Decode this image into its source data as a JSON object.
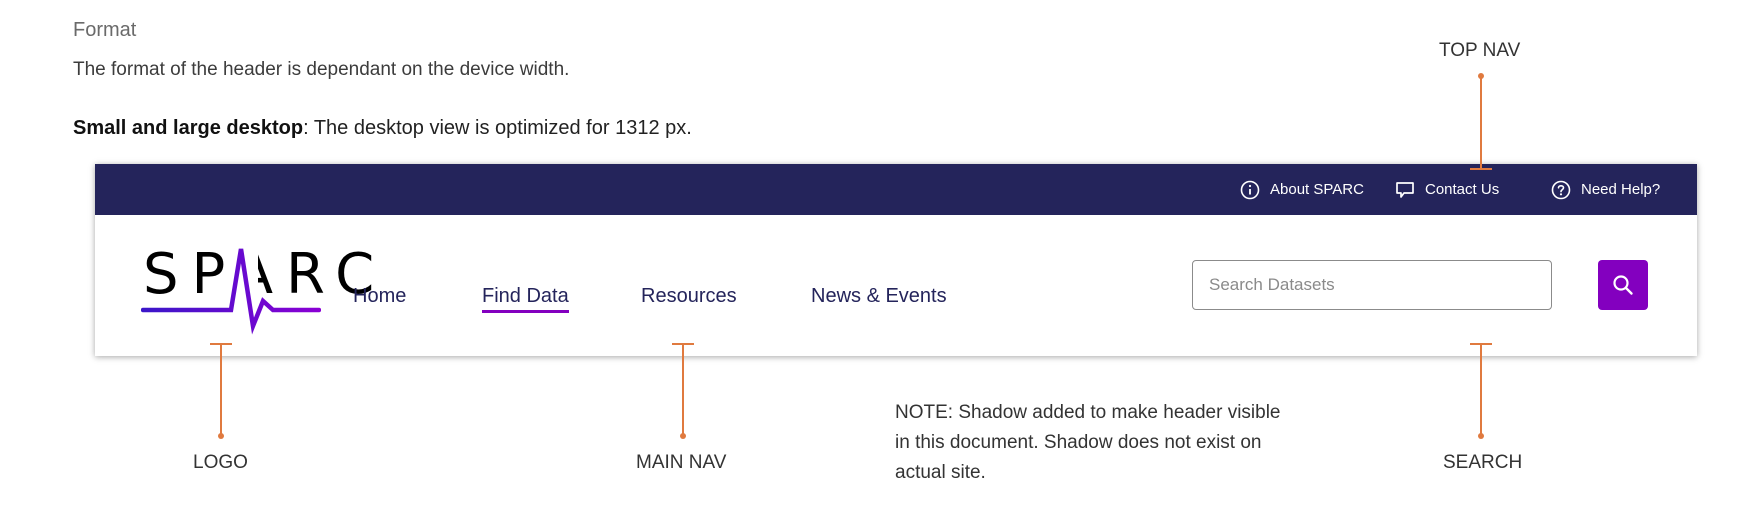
{
  "doc": {
    "heading": "Format",
    "description": "The format of the header is dependant on the device width.",
    "spec_bold": "Small and large desktop",
    "spec_rest": ": The desktop view is optimized for 1312 px."
  },
  "header": {
    "top_nav": [
      {
        "label": "About SPARC",
        "icon": "info-circle-icon"
      },
      {
        "label": "Contact Us",
        "icon": "chat-bubble-icon"
      },
      {
        "label": "Need Help?",
        "icon": "question-circle-icon"
      }
    ],
    "logo_text": "SPARC",
    "main_nav": [
      {
        "label": "Home",
        "active": false
      },
      {
        "label": "Find Data",
        "active": true
      },
      {
        "label": "Resources",
        "active": false
      },
      {
        "label": "News & Events",
        "active": false
      }
    ],
    "search": {
      "placeholder": "Search Datasets",
      "button_icon": "search-icon"
    }
  },
  "annotations": {
    "top_nav": "TOP NAV",
    "logo": "LOGO",
    "main_nav": "MAIN NAV",
    "search": "SEARCH",
    "note": "NOTE: Shadow added to make header visible in this document. Shadow does not exist on actual site."
  },
  "colors": {
    "topbar": "#24245b",
    "accent": "#8300bf",
    "callout": "#e07a3f",
    "nav_text": "#24245b"
  }
}
